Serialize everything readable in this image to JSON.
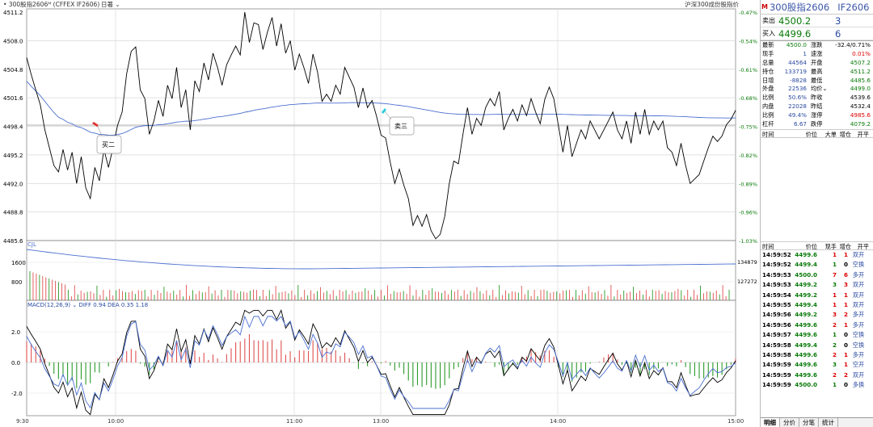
{
  "topbar": {
    "instrument": "• 300股指2606ᴹ (CFFEX IF2606)",
    "period": "日著 ⌄",
    "index_label": "沪深300成份股指价"
  },
  "panel": {
    "badge": "M",
    "name": "300股指2606",
    "code": "IF2606",
    "sell_label": "卖出",
    "sell_price": "4500.2",
    "sell_vol": "3",
    "buy_label": "买入",
    "buy_price": "4499.6",
    "buy_vol": "6",
    "stats": [
      {
        "l1": "最新",
        "v1": "4500.0",
        "c1": "g",
        "l2": "涨跌",
        "v2": "-32.4/0.71%",
        "c2": "k"
      },
      {
        "l1": "现手",
        "v1": "1",
        "c1": "b",
        "l2": "速涨",
        "v2": "0.01%",
        "c2": "r"
      },
      {
        "l1": "总量",
        "v1": "44564",
        "c1": "b",
        "l2": "开盘",
        "v2": "4507.2",
        "c2": "g"
      },
      {
        "l1": "持仓",
        "v1": "133719",
        "c1": "b",
        "l2": "最高",
        "v2": "4511.2",
        "c2": "g"
      },
      {
        "l1": "日增",
        "v1": "-8828",
        "c1": "b",
        "l2": "最低",
        "v2": "4485.6",
        "c2": "g"
      },
      {
        "l1": "外盘",
        "v1": "22536",
        "c1": "b",
        "l2": "均价⌄",
        "v2": "4499.0",
        "c2": "g"
      },
      {
        "l1": "比例",
        "v1": "50.6%",
        "c1": "b",
        "l2": "昨收",
        "v2": "4539.6",
        "c2": "k"
      },
      {
        "l1": "内盘",
        "v1": "22028",
        "c1": "b",
        "l2": "昨结",
        "v2": "4532.4",
        "c2": "k"
      },
      {
        "l1": "比例",
        "v1": "49.4%",
        "c1": "b",
        "l2": "涨停",
        "v2": "4985.6",
        "c2": "r"
      },
      {
        "l1": "杠杆",
        "v1": "6.67",
        "c1": "b",
        "l2": "跌停",
        "v2": "4079.2",
        "c2": "g"
      }
    ],
    "hdr1": [
      "时间",
      "价位",
      "大单",
      "增仓",
      "开平"
    ],
    "hdr2": [
      "时间",
      "价位",
      "现手",
      "增仓",
      "开平"
    ],
    "ticks": [
      {
        "t": "14:59:52",
        "p": "4499.6",
        "v": "1",
        "vc": "r",
        "c": "1",
        "cc": "r",
        "k": "双开"
      },
      {
        "t": "14:59:52",
        "p": "4499.4",
        "v": "1",
        "vc": "g",
        "c": "0",
        "cc": "k",
        "k": "空换"
      },
      {
        "t": "14:59:53",
        "p": "4500.0",
        "v": "7",
        "vc": "r",
        "c": "6",
        "cc": "r",
        "k": "多开"
      },
      {
        "t": "14:59:53",
        "p": "4499.2",
        "v": "3",
        "vc": "g",
        "c": "3",
        "cc": "r",
        "k": "双开"
      },
      {
        "t": "14:59:54",
        "p": "4499.2",
        "v": "1",
        "vc": "r",
        "c": "1",
        "cc": "r",
        "k": "双开"
      },
      {
        "t": "14:59:55",
        "p": "4499.4",
        "v": "1",
        "vc": "r",
        "c": "1",
        "cc": "r",
        "k": "双开"
      },
      {
        "t": "14:59:56",
        "p": "4499.2",
        "v": "3",
        "vc": "r",
        "c": "2",
        "cc": "r",
        "k": "多开"
      },
      {
        "t": "14:59:56",
        "p": "4499.6",
        "v": "2",
        "vc": "r",
        "c": "1",
        "cc": "r",
        "k": "多开"
      },
      {
        "t": "14:59:57",
        "p": "4499.6",
        "v": "1",
        "vc": "g",
        "c": "0",
        "cc": "k",
        "k": "空换"
      },
      {
        "t": "14:59:58",
        "p": "4499.4",
        "v": "2",
        "vc": "g",
        "c": "0",
        "cc": "k",
        "k": "空换"
      },
      {
        "t": "14:59:58",
        "p": "4499.6",
        "v": "2",
        "vc": "r",
        "c": "1",
        "cc": "r",
        "k": "多开"
      },
      {
        "t": "14:59:59",
        "p": "4499.6",
        "v": "3",
        "vc": "g",
        "c": "1",
        "cc": "r",
        "k": "空开"
      },
      {
        "t": "14:59:59",
        "p": "4499.6",
        "v": "2",
        "vc": "r",
        "c": "2",
        "cc": "r",
        "k": "双开"
      },
      {
        "t": "14:59:59",
        "p": "4500.0",
        "v": "1",
        "vc": "g",
        "c": "0",
        "cc": "k",
        "k": "多换"
      }
    ],
    "tabs": [
      "明细",
      "分价",
      "分笔",
      "统计"
    ]
  },
  "chart_data": {
    "type": "line",
    "price_ticks": [
      "4511.2",
      "4508.0",
      "4504.8",
      "4501.6",
      "4498.4",
      "4495.2",
      "4492.0",
      "4488.8",
      "4485.6"
    ],
    "pct_ticks": [
      "-0.47%",
      "-0.54%",
      "-0.61%",
      "-0.68%",
      "-0.75%",
      "-0.82%",
      "-0.89%",
      "-0.96%",
      "-1.03%"
    ],
    "vol_ticks_left": [
      "1600",
      "800"
    ],
    "vol_ticks_right": [
      "134879",
      "127272"
    ],
    "macd_ticks": [
      "2.0",
      "0.0",
      "-2.0"
    ],
    "time_labels": [
      "9:30",
      "10:00",
      "11:00",
      "13:00",
      "14:00",
      "15:00"
    ],
    "cjl_label": "CJL",
    "macd_label": "MACD(12,26,9) ⌄  DIFF 0.94  DEA 0.35   1.18",
    "annotations": [
      "买二",
      "卖三"
    ],
    "ylim": [
      4485.6,
      4511.2
    ],
    "price": [
      4506.1,
      4504.2,
      4502.5,
      4500.8,
      4498.0,
      4496.0,
      4494.0,
      4493.3,
      4495.8,
      4493.5,
      4495.5,
      4492.0,
      4495.0,
      4491.5,
      4490.3,
      4493.8,
      4492.3,
      4495.8,
      4493.8,
      4496.0,
      4498.5,
      4500.0,
      4504.3,
      4506.8,
      4507.3,
      4502.5,
      4501.5,
      4497.5,
      4499.0,
      4501.3,
      4499.5,
      4503.0,
      4501.5,
      4505.0,
      4500.5,
      4502.5,
      4498.0,
      4503.5,
      4502.3,
      4505.5,
      4503.6,
      4506.6,
      4505.0,
      4503.0,
      4505.3,
      4506.4,
      4507.4,
      4506.4,
      4511.2,
      4507.8,
      4510.0,
      4509.8,
      4507.0,
      4509.0,
      4510.6,
      4507.4,
      4509.9,
      4506.6,
      4508.0,
      4504.7,
      4506.5,
      4505.0,
      4503.2,
      4506.5,
      4504.5,
      4501.2,
      4502.0,
      4501.2,
      4503.0,
      4502.0,
      4505.0,
      4503.9,
      4502.8,
      4500.5,
      4502.7,
      4500.5,
      4501.3,
      4499.5,
      4497.4,
      4497.1,
      4494.4,
      4492.0,
      4493.6,
      4491.8,
      4490.3,
      4487.3,
      4488.4,
      4487.2,
      4488.5,
      4486.7,
      4485.8,
      4486.3,
      4488.3,
      4492.0,
      4494.5,
      4494.2,
      4497.5,
      4500.5,
      4497.5,
      4499.3,
      4498.5,
      4500.5,
      4501.5,
      4500.7,
      4502.3,
      4498.0,
      4499.3,
      4500.3,
      4499.0,
      4500.8,
      4499.6,
      4501.5,
      4500.0,
      4498.7,
      4501.4,
      4502.8,
      4501.5,
      4498.5,
      4495.5,
      4498.5,
      4495.0,
      4496.5,
      4498.0,
      4497.0,
      4499.0,
      4498.0,
      4497.0,
      4498.0,
      4499.0,
      4500.0,
      4498.0,
      4497.0,
      4499.0,
      4496.5,
      4500.0,
      4497.5,
      4500.3,
      4497.5,
      4499.0,
      4498.0,
      4499.0,
      4496.0,
      4495.5,
      4494.0,
      4496.5,
      4494.0,
      4492.0,
      4492.5,
      4493.0,
      4494.5,
      4496.0,
      4497.3,
      4496.7,
      4497.3,
      4498.6,
      4499.2,
      4500.2
    ]
  }
}
